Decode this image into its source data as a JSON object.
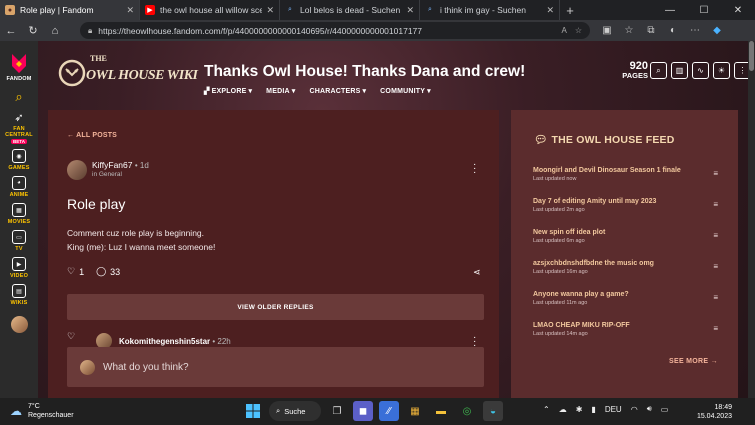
{
  "browser": {
    "tabs": [
      {
        "title": "Role play | Fandom",
        "icon": "fandom-favicon",
        "active": true
      },
      {
        "title": "the owl house all willow scenes",
        "icon": "youtube-favicon",
        "active": false
      },
      {
        "title": "Lol belos is dead - Suchen",
        "icon": "bing-favicon",
        "active": false
      },
      {
        "title": "i think im gay - Suchen",
        "icon": "bing-favicon",
        "active": false
      }
    ],
    "url": "https://theowlhouse.fandom.com/f/p/4400000000000140695/r/4400000000001017177"
  },
  "rail": {
    "items": [
      {
        "label": "FANDOM"
      },
      {
        "label": "FAN CENTRAL",
        "badge": "BETA"
      },
      {
        "label": "GAMES"
      },
      {
        "label": "ANIME"
      },
      {
        "label": "MOVIES"
      },
      {
        "label": "TV"
      },
      {
        "label": "VIDEO"
      },
      {
        "label": "WIKIS"
      }
    ]
  },
  "wiki": {
    "logo_text_top": "THE",
    "logo_text_main": "OWL HOUSE WIKI",
    "title": "Thanks Owl House! Thanks Dana and crew!",
    "pages_count": "920",
    "pages_label": "PAGES",
    "nav": [
      {
        "label": "EXPLORE"
      },
      {
        "label": "MEDIA"
      },
      {
        "label": "CHARACTERS"
      },
      {
        "label": "COMMUNITY"
      }
    ]
  },
  "post": {
    "back_label": "ALL POSTS",
    "author": "KiffyFan67",
    "time": "1d",
    "category": "in General",
    "title": "Role play",
    "body_line1": "Comment cuz role play is beginning.",
    "body_line2": "King (me): Luz I wanna meet someone!",
    "likes": "1",
    "comments": "33",
    "older_replies_label": "VIEW OLDER REPLIES",
    "reply_author": "Kokomithegenshin5star",
    "reply_time": "22h",
    "comment_placeholder": "What do you think?"
  },
  "feed": {
    "title": "THE OWL HOUSE FEED",
    "items": [
      {
        "title": "Moongirl and Devil Dinosaur Season 1 finale",
        "updated": "Last updated now"
      },
      {
        "title": "Day 7 of editing Amity until may 2023",
        "updated": "Last updated 2m ago"
      },
      {
        "title": "New spin off idea plot",
        "updated": "Last updated 6m ago"
      },
      {
        "title": "azsjxchbdnshdfbdne the music omg",
        "updated": "Last updated 16m ago"
      },
      {
        "title": "Anyone wanna play a game?",
        "updated": "Last updated 11m ago"
      },
      {
        "title": "LMAO CHEAP MIKU RIP-OFF",
        "updated": "Last updated 14m ago"
      }
    ],
    "see_more": "SEE MORE"
  },
  "taskbar": {
    "weather_temp": "7°C",
    "weather_desc": "Regenschauer",
    "search_label": "Suche",
    "lang": "DEU",
    "time": "18:49",
    "date": "15.04.2023"
  },
  "colors": {
    "accent_peach": "#f4b49b",
    "feed_link": "#f2c89e",
    "card_bg": "#4d1f20",
    "feed_bg": "#5b2c2d",
    "fandom_pink": "#fa005a"
  }
}
